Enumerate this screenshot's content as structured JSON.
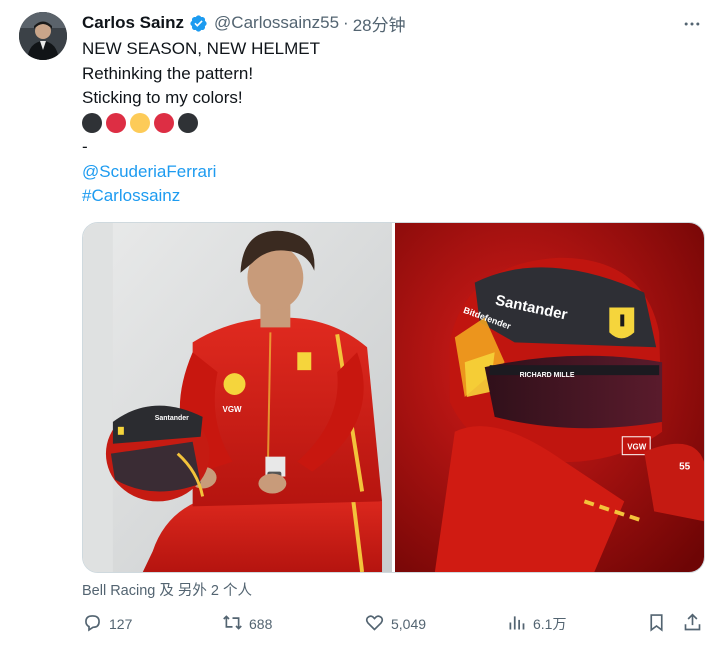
{
  "tweet": {
    "author_name": "Carlos Sainz",
    "handle": "@Carlossainz55",
    "separator": "·",
    "time": "28分钟",
    "lines": [
      "NEW SEASON, NEW HELMET",
      "Rethinking the pattern!",
      "Sticking to my colors!"
    ],
    "dash": "-",
    "mention": "@ScuderiaFerrari",
    "hashtag": "#Carlossainz",
    "emoji_colors": [
      "#2f3236",
      "#dd2e44",
      "#fdcb58",
      "#dd2e44",
      "#2f3236"
    ],
    "tagged": "Bell Racing 及 另外 2 个人"
  },
  "actions": {
    "replies": "127",
    "retweets": "688",
    "likes": "5,049",
    "views": "6.1万"
  },
  "photos": {
    "left_logos": [
      "Santander",
      "VGW"
    ],
    "right_texts": [
      "Santander",
      "Bitdefender",
      "RICHARD MILLE",
      "VGW",
      "55"
    ]
  },
  "icons": {
    "verified": "verified-badge-icon",
    "more": "more-icon",
    "reply": "reply-icon",
    "retweet": "retweet-icon",
    "like": "like-icon",
    "views": "views-icon",
    "bookmark": "bookmark-icon",
    "share": "share-icon"
  },
  "colors": {
    "link": "#1d9bf0",
    "secondary_text": "#536471",
    "verified": "#1d9bf0"
  }
}
